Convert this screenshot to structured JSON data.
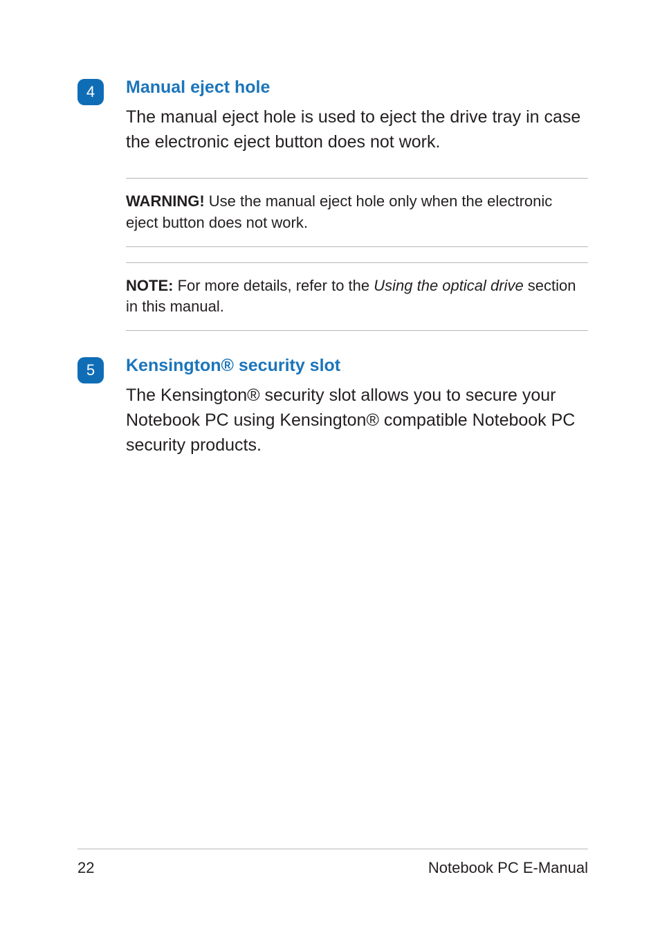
{
  "items": [
    {
      "number": "4",
      "heading": "Manual eject hole",
      "body": "The manual eject hole is used to eject the drive tray in case the electronic eject button does not work.",
      "callouts": [
        {
          "strong": "WARNING!",
          "rest": " Use the manual eject hole only when the electronic eject button does not work."
        },
        {
          "strong": "NOTE:",
          "rest_before": " For more details, refer to the ",
          "em": "Using the optical drive",
          "rest_after": " section in this manual."
        }
      ]
    },
    {
      "number": "5",
      "heading": "Kensington® security slot",
      "body": "The Kensington® security slot allows you to secure your Notebook PC using Kensington® compatible Notebook PC security products."
    }
  ],
  "footer": {
    "page_number": "22",
    "doc_title": "Notebook PC E-Manual"
  }
}
